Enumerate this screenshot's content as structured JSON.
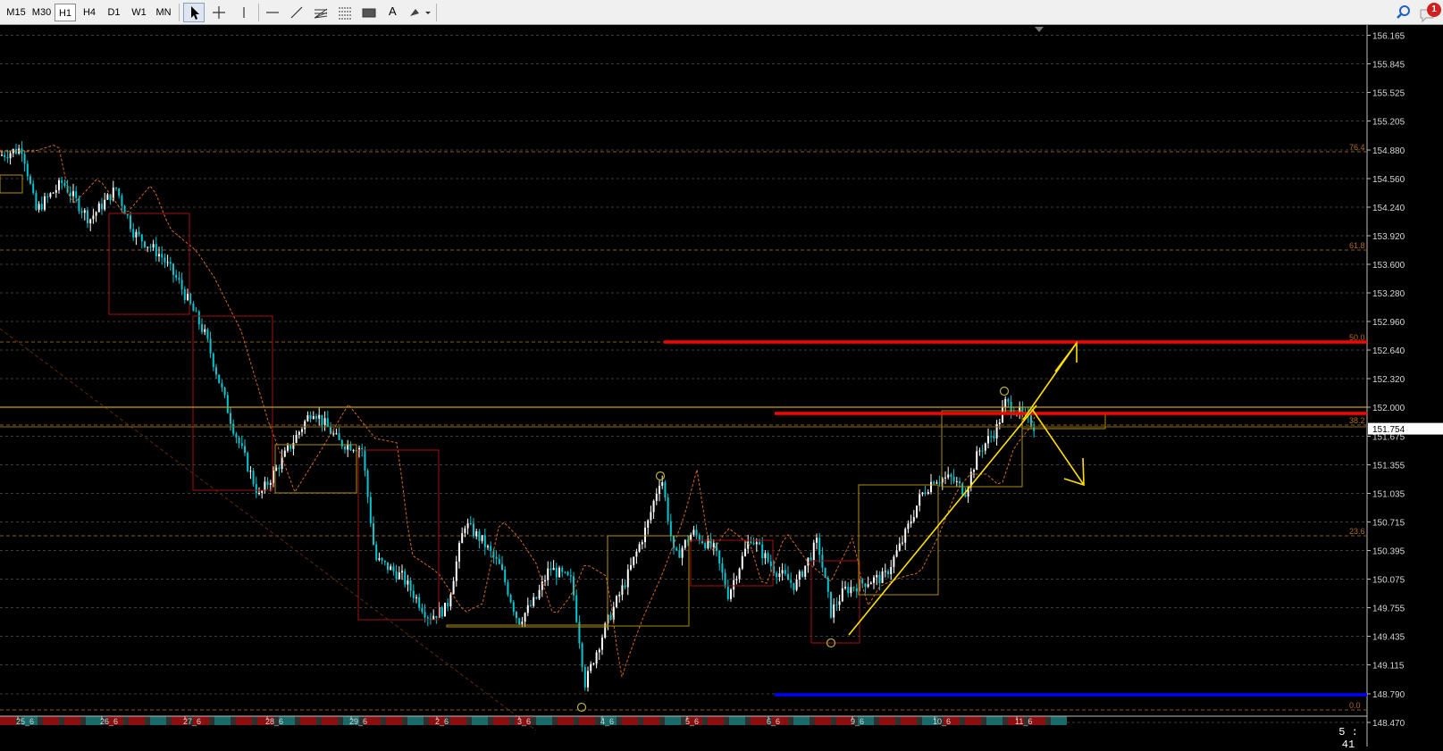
{
  "toolbar": {
    "timeframes": [
      {
        "label": "M15",
        "active": false
      },
      {
        "label": "M30",
        "active": false
      },
      {
        "label": "H1",
        "active": true
      },
      {
        "label": "H4",
        "active": false
      },
      {
        "label": "D1",
        "active": false
      },
      {
        "label": "W1",
        "active": false
      },
      {
        "label": "MN",
        "active": false
      }
    ],
    "tools": [
      "cursor-icon",
      "crosshair-icon",
      "vertical-line-icon",
      "horizontal-line-icon",
      "trendline-icon",
      "fibonacci-fan-icon",
      "fibonacci-retracement-icon",
      "rectangle-icon",
      "text-label-icon",
      "shapes-menu-icon"
    ],
    "text_tool_label": "A",
    "notification_count": "1"
  },
  "chart": {
    "background": "#000000",
    "bull_color": "#ffffff",
    "bear_color": "#00c8d2",
    "price_axis_labels": [
      "156.165",
      "155.845",
      "155.525",
      "155.205",
      "154.880",
      "154.560",
      "154.240",
      "153.920",
      "153.600",
      "153.280",
      "152.960",
      "152.640",
      "152.320",
      "152.000",
      "151.675",
      "151.355",
      "151.035",
      "150.715",
      "150.395",
      "150.075",
      "149.755",
      "149.435",
      "149.115",
      "148.790",
      "148.470"
    ],
    "current_price": "151.754",
    "date_labels": [
      "25_6",
      "26_6",
      "27_6",
      "28_6",
      "29_6",
      "2_6",
      "3_6",
      "4_6",
      "5_6",
      "6_6",
      "9_6",
      "10_6",
      "11_6"
    ],
    "fib_levels": [
      {
        "label": "76.4",
        "price": 154.86
      },
      {
        "label": "61.8",
        "price": 153.76
      },
      {
        "label": "50.0",
        "price": 152.73
      },
      {
        "label": "38.2",
        "price": 151.8
      },
      {
        "label": "23.6",
        "price": 150.56
      },
      {
        "label": "0.0",
        "price": 148.61
      }
    ],
    "horizontal_lines": [
      {
        "name": "red-resistance-line",
        "color": "#ff0000",
        "price": 152.73
      },
      {
        "name": "red-mid-line",
        "color": "#ff0000",
        "price": 151.93
      },
      {
        "name": "blue-support-line",
        "color": "#0000ff",
        "price": 148.78
      },
      {
        "name": "gold-level-line",
        "color": "#c8a000",
        "price": 152.0
      }
    ],
    "countdown": "5 : 41"
  }
}
